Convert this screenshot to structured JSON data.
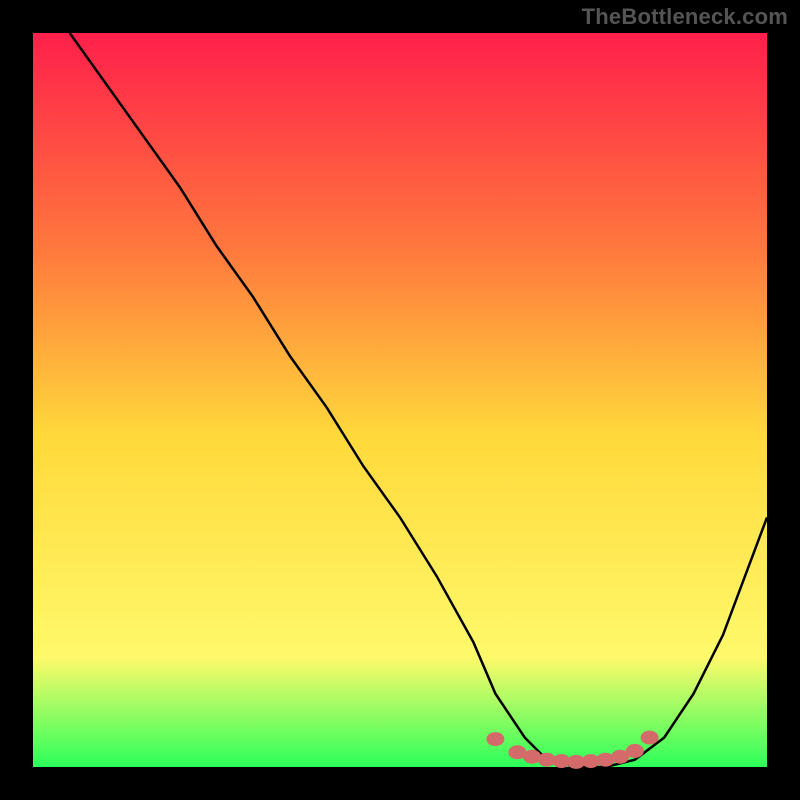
{
  "watermark": "TheBottleneck.com",
  "chart_data": {
    "type": "line",
    "title": "",
    "xlabel": "",
    "ylabel": "",
    "xlim": [
      0,
      100
    ],
    "ylim": [
      0,
      100
    ],
    "grid": false,
    "legend": false,
    "plot_background_gradient": {
      "top": "#ff1f4b",
      "mid_upper": "#ff7a3d",
      "mid": "#ffd93b",
      "mid_lower": "#fff96b",
      "bottom": "#2cff5a"
    },
    "series": [
      {
        "name": "bottleneck-curve",
        "stroke": "#000000",
        "x": [
          5,
          10,
          15,
          20,
          25,
          30,
          35,
          40,
          45,
          50,
          55,
          60,
          63,
          67,
          70,
          74,
          78,
          82,
          86,
          90,
          94,
          100
        ],
        "values": [
          100,
          93,
          86,
          79,
          71,
          64,
          56,
          49,
          41,
          34,
          26,
          17,
          10,
          4,
          1,
          0,
          0,
          1,
          4,
          10,
          18,
          34
        ]
      }
    ],
    "markers": {
      "name": "highlight-dots",
      "color": "#d46a6a",
      "x": [
        63,
        66,
        68,
        70,
        72,
        74,
        76,
        78,
        80,
        82,
        84
      ],
      "values": [
        3.8,
        2.0,
        1.4,
        1.0,
        0.8,
        0.7,
        0.8,
        1.0,
        1.4,
        2.2,
        4.0
      ]
    }
  }
}
